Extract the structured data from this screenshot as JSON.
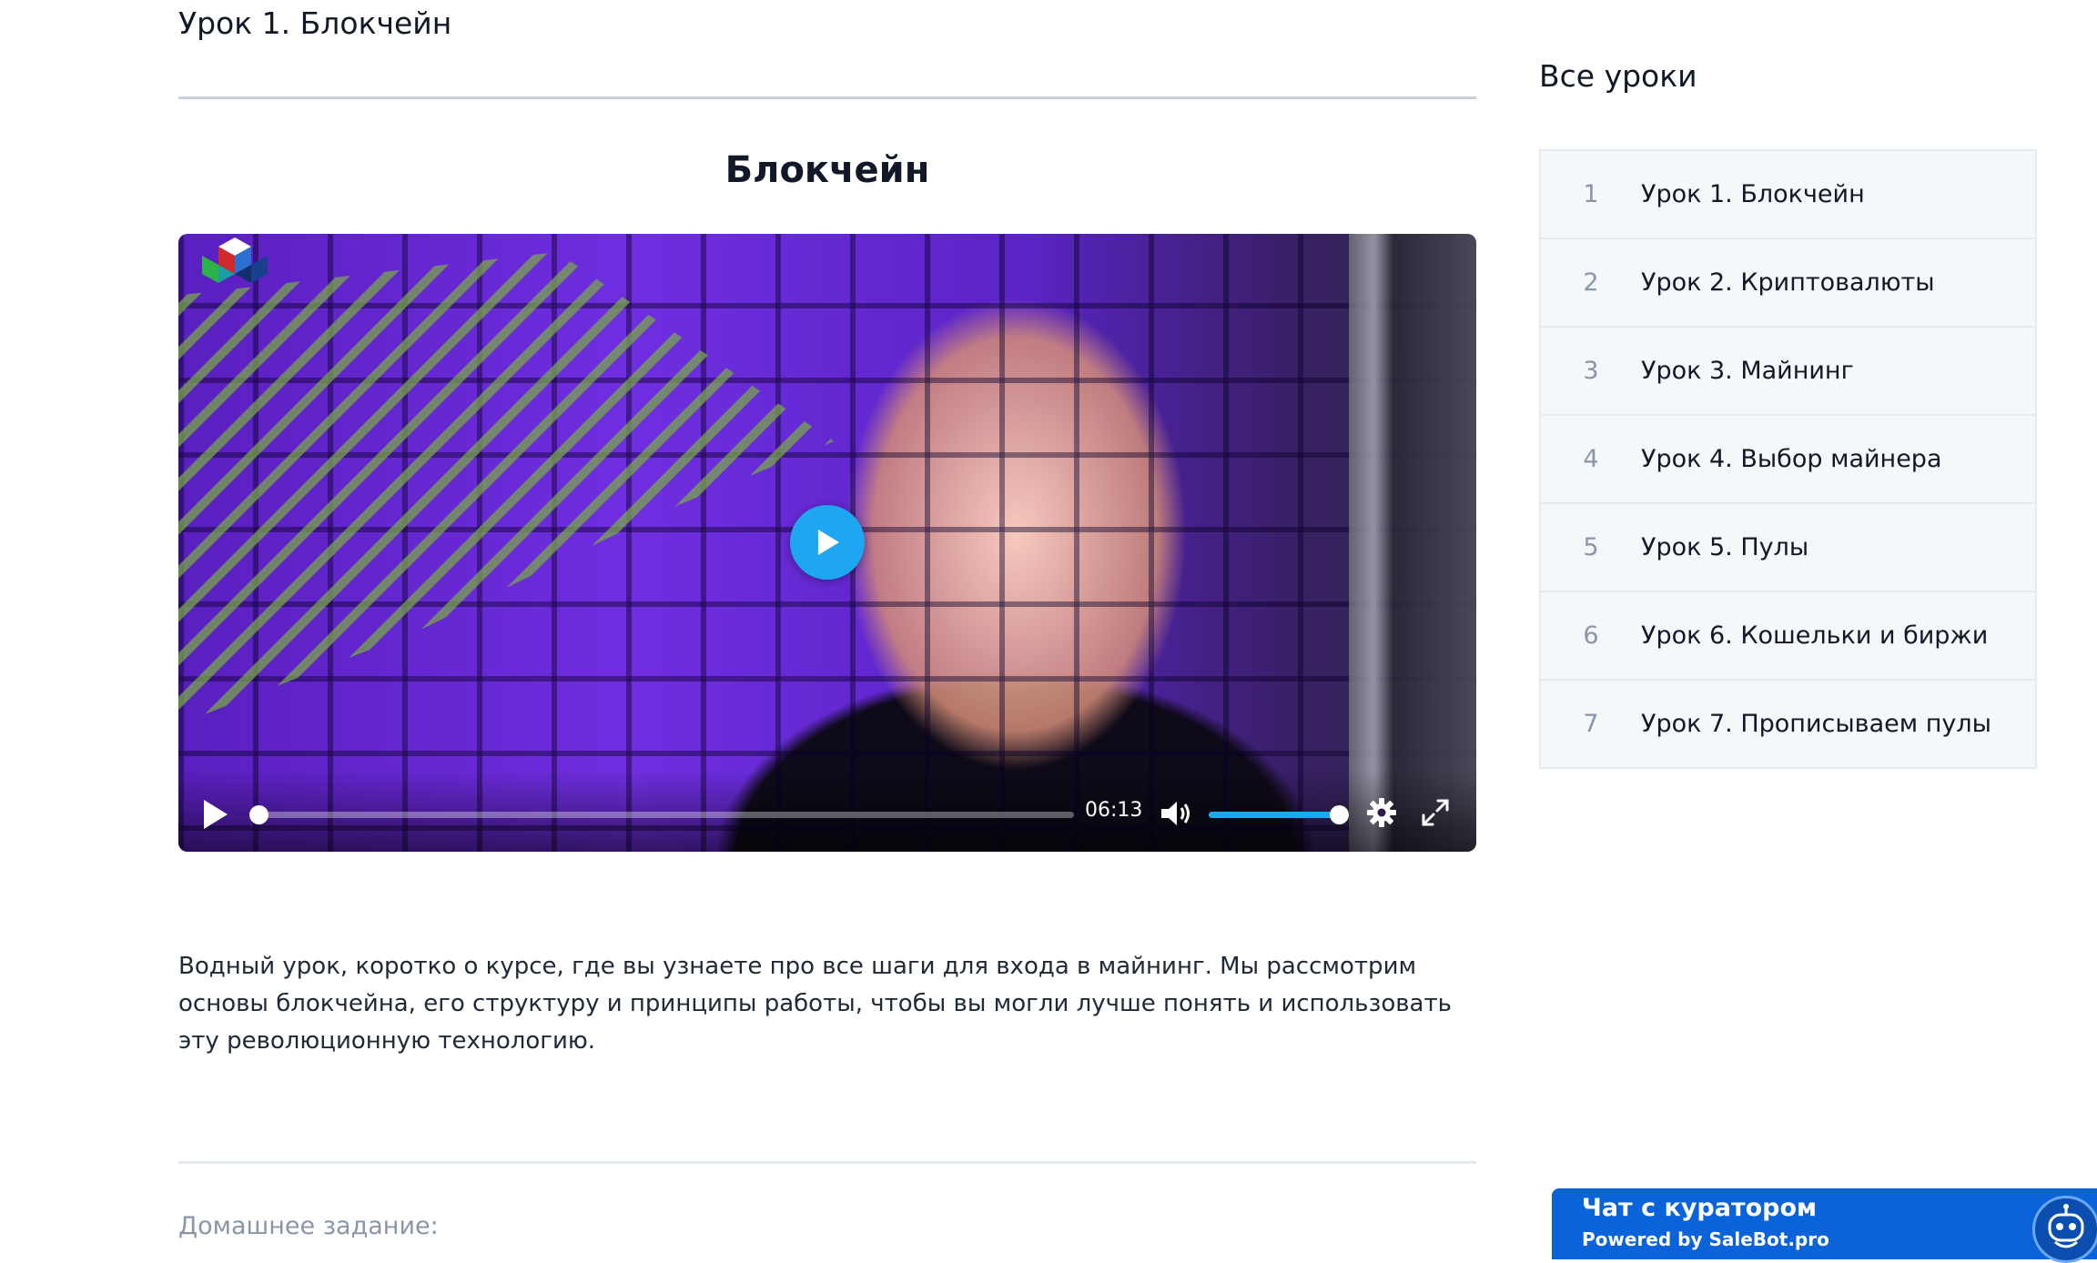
{
  "lesson": {
    "header": "Урок 1. Блокчейн",
    "video_title": "Блокчейн",
    "description": "Водный урок, коротко о курсе, где вы узнаете про все шаги для входа в майнинг. Мы рассмотрим основы блокчейна, его структуру и принципы работы, чтобы вы могли лучше понять и использовать эту революционную технологию.",
    "homework_label": "Домашнее задание:"
  },
  "video_player": {
    "duration": "06:13",
    "progress": 0,
    "volume": 1.0,
    "play_color": "#1ea6f0"
  },
  "sidebar": {
    "title": "Все уроки",
    "lessons": [
      {
        "num": "1",
        "label": "Урок 1. Блокчейн"
      },
      {
        "num": "2",
        "label": "Урок 2. Криптовалюты"
      },
      {
        "num": "3",
        "label": "Урок 3. Майнинг"
      },
      {
        "num": "4",
        "label": "Урок 4. Выбор майнера"
      },
      {
        "num": "5",
        "label": "Урок 5. Пулы"
      },
      {
        "num": "6",
        "label": "Урок 6. Кошельки и биржи"
      },
      {
        "num": "7",
        "label": "Урок 7. Прописываем пулы"
      }
    ]
  },
  "chat_widget": {
    "title": "Чат с куратором",
    "powered_by": "Powered by SaleBot.pro",
    "color": "#0a63d9"
  }
}
